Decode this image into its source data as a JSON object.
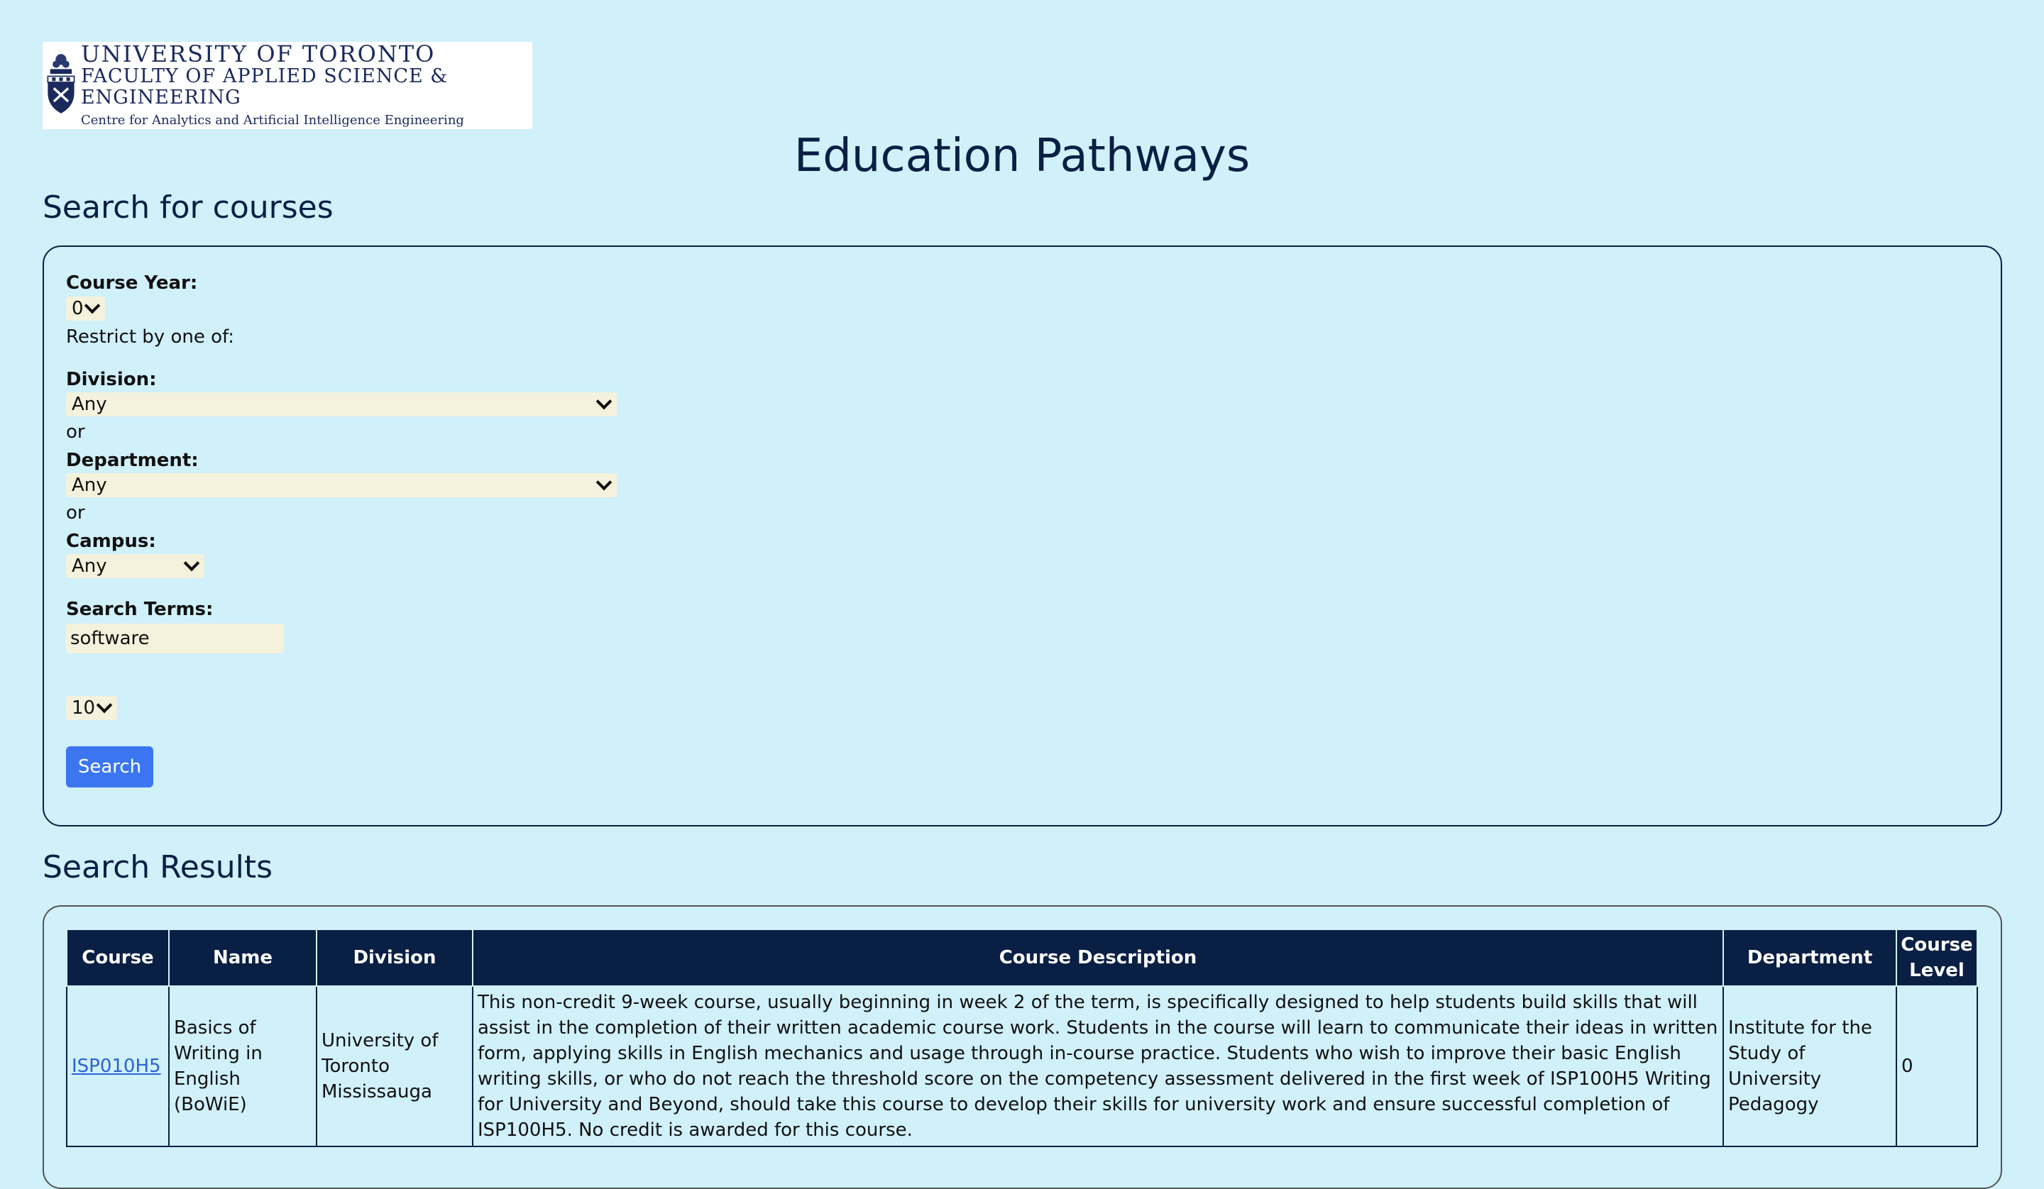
{
  "logo": {
    "line1": "UNIVERSITY OF TORONTO",
    "line2": "FACULTY OF APPLIED SCIENCE & ENGINEERING",
    "line3": "Centre for Analytics and Artificial Intelligence Engineering"
  },
  "page_title": "Education Pathways",
  "search": {
    "section_title": "Search for courses",
    "course_year_label": "Course Year:",
    "course_year_value": "0",
    "restrict_label": "Restrict by one of:",
    "division_label": "Division:",
    "division_value": "Any",
    "or_1": "or",
    "department_label": "Department:",
    "department_value": "Any",
    "or_2": "or",
    "campus_label": "Campus:",
    "campus_value": "Any",
    "terms_label": "Search Terms:",
    "terms_value": "software",
    "results_per_page_value": "10",
    "search_button": "Search"
  },
  "results": {
    "section_title": "Search Results",
    "columns": [
      "Course",
      "Name",
      "Division",
      "Course Description",
      "Department",
      "Course Level"
    ],
    "rows": [
      {
        "course": "ISP010H5",
        "name": "Basics of Writing in English (BoWiE)",
        "division": "University of Toronto Mississauga",
        "description": "This non-credit 9-week course, usually beginning in week 2 of the term, is specifically designed to help students build skills that will assist in the completion of their written academic course work. Students in the course will learn to communicate their ideas in written form, applying skills in English mechanics and usage through in-course practice. Students who wish to improve their basic English writing skills, or who do not reach the threshold score on the competency assessment delivered in the first week of ISP100H5 Writing for University and Beyond, should take this course to develop their skills for university work and ensure successful completion of ISP100H5. No credit is awarded for this course.",
        "department": "Institute for the Study of University Pedagogy",
        "level": "0"
      }
    ]
  }
}
